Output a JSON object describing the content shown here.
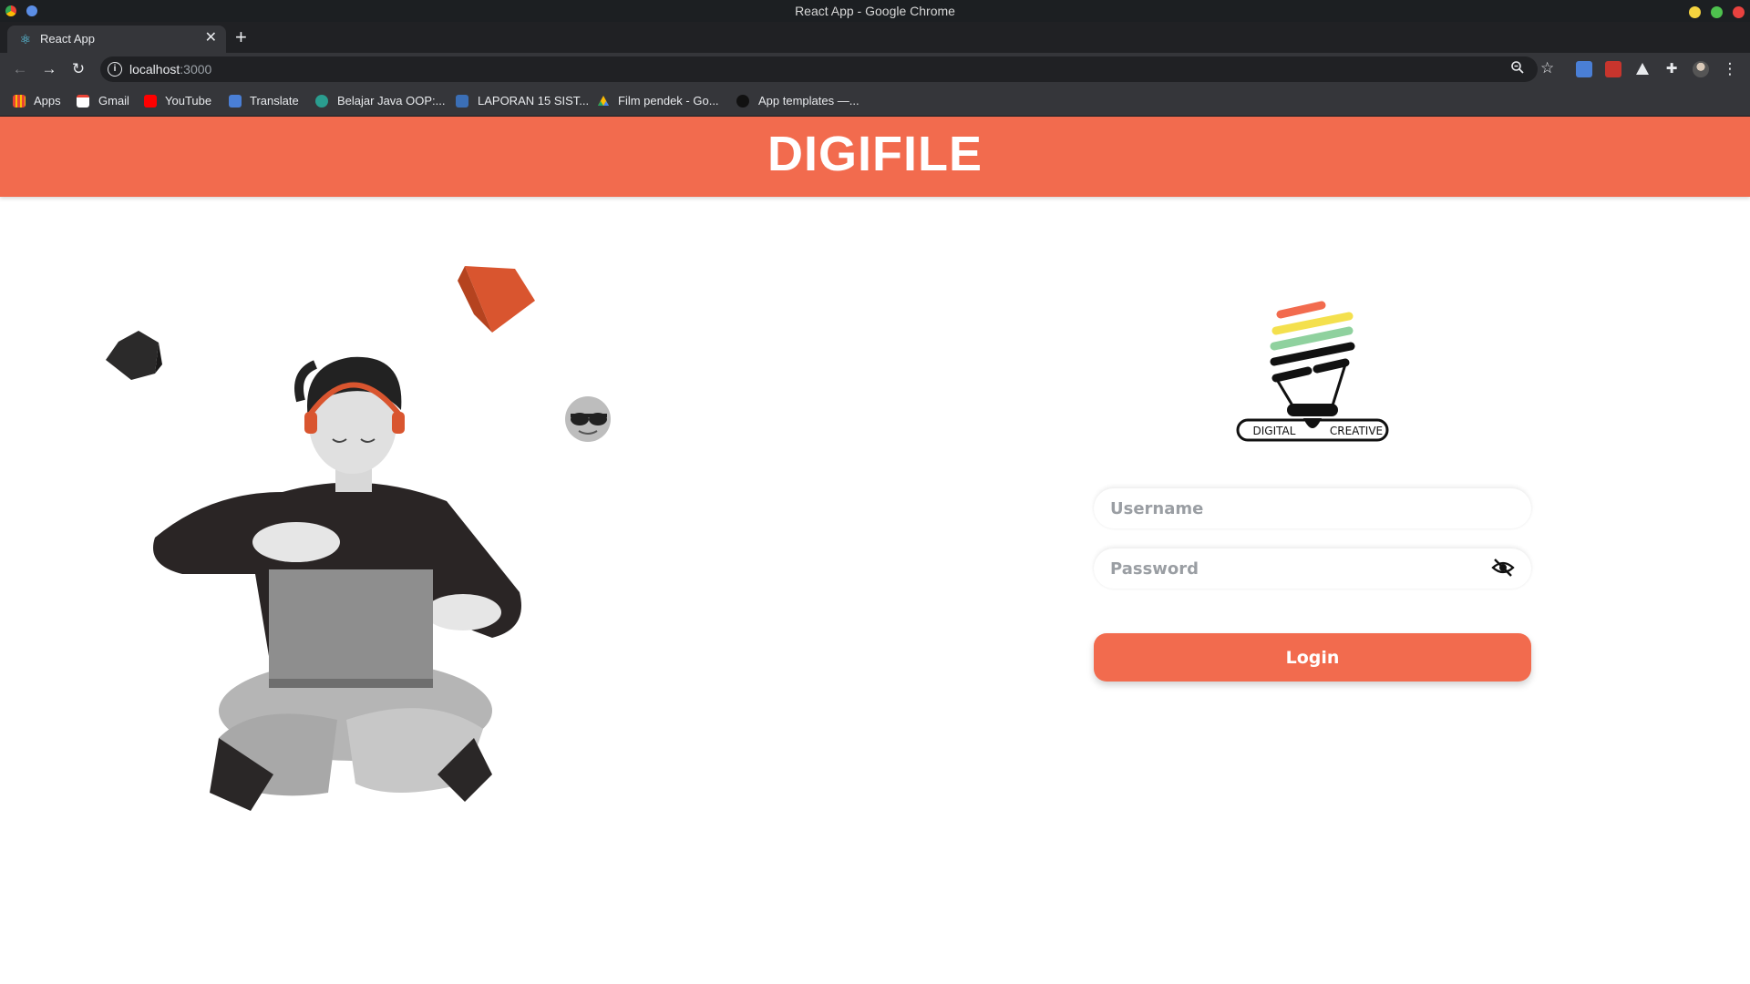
{
  "window": {
    "title": "React App - Google Chrome"
  },
  "tab": {
    "title": "React App"
  },
  "omnibox": {
    "host": "localhost",
    "port": ":3000"
  },
  "bookmarks": [
    {
      "label": "Apps",
      "icon": "apps-grid-icon"
    },
    {
      "label": "Gmail",
      "icon": "gmail-icon"
    },
    {
      "label": "YouTube",
      "icon": "youtube-icon"
    },
    {
      "label": "Translate",
      "icon": "translate-icon"
    },
    {
      "label": "Belajar Java OOP:...",
      "icon": "site-icon"
    },
    {
      "label": "LAPORAN 15 SIST...",
      "icon": "site-icon"
    },
    {
      "label": "Film pendek - Go...",
      "icon": "google-drive-icon"
    },
    {
      "label": "App templates —...",
      "icon": "site-icon"
    }
  ],
  "app": {
    "brand": "DIGIFILE",
    "logo_text_left": "DIGITAL",
    "logo_text_right": "CREATIVE",
    "username_placeholder": "Username",
    "password_placeholder": "Password",
    "login_label": "Login"
  },
  "colors": {
    "accent": "#f26b4e",
    "chrome_dark": "#202124",
    "chrome_toolbar": "#35363a"
  }
}
